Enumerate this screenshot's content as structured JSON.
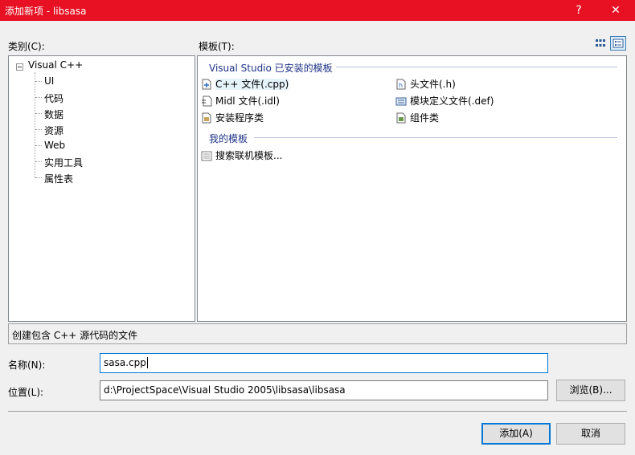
{
  "window": {
    "title": "添加新项 - libsasa",
    "help": "?",
    "close": "✕"
  },
  "categories": {
    "label": "类别(C):",
    "root": "Visual C++",
    "children": [
      "UI",
      "代码",
      "数据",
      "资源",
      "Web",
      "实用工具",
      "属性表"
    ]
  },
  "templates": {
    "label": "模板(T):",
    "installed_header": "Visual Studio 已安装的模板",
    "installed": [
      {
        "label": "C++ 文件(.cpp)",
        "icon": "cpp-file-icon",
        "selected": true
      },
      {
        "label": "头文件(.h)",
        "icon": "header-file-icon"
      },
      {
        "label": "Midl 文件(.idl)",
        "icon": "midl-file-icon"
      },
      {
        "label": "模块定义文件(.def)",
        "icon": "def-file-icon"
      },
      {
        "label": "安装程序类",
        "icon": "installer-class-icon"
      },
      {
        "label": "组件类",
        "icon": "component-class-icon"
      }
    ],
    "my_header": "我的模板",
    "my": [
      {
        "label": "搜索联机模板...",
        "icon": "search-online-icon"
      }
    ]
  },
  "description": "创建包含 C++ 源代码的文件",
  "name_field": {
    "label": "名称(N):",
    "value": "sasa.cpp"
  },
  "location_field": {
    "label": "位置(L):",
    "value": "d:\\ProjectSpace\\Visual Studio 2005\\libsasa\\libsasa"
  },
  "buttons": {
    "browse": "浏览(B)...",
    "add": "添加(A)",
    "cancel": "取消"
  },
  "colors": {
    "titlebar": "#e81123",
    "group_header": "#1e3287",
    "focus": "#0078d7"
  }
}
